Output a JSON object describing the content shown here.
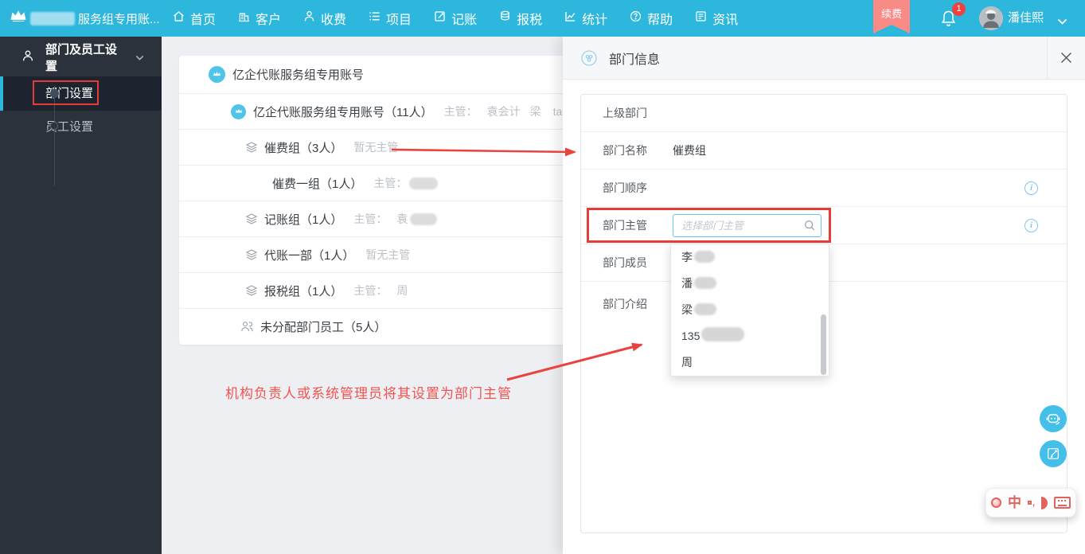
{
  "topbar": {
    "brand_text": "服务组专用账...",
    "nav": [
      {
        "label": "首页",
        "icon": "home-icon"
      },
      {
        "label": "客户",
        "icon": "customers-icon"
      },
      {
        "label": "收费",
        "icon": "fees-icon"
      },
      {
        "label": "项目",
        "icon": "projects-icon"
      },
      {
        "label": "记账",
        "icon": "bookkeeping-icon"
      },
      {
        "label": "报税",
        "icon": "tax-icon"
      },
      {
        "label": "统计",
        "icon": "stats-icon"
      },
      {
        "label": "帮助",
        "icon": "help-icon"
      },
      {
        "label": "资讯",
        "icon": "news-icon"
      }
    ],
    "renew_label": "续费",
    "notification_count": "1",
    "user_name": "潘佳熙"
  },
  "sidebar": {
    "header_label": "部门及员工设置",
    "items": [
      {
        "label": "部门设置",
        "active": true
      },
      {
        "label": "员工设置",
        "active": false
      }
    ]
  },
  "tree": {
    "root_title": "亿企代账服务组专用账号",
    "rows": [
      {
        "name": "亿企代账服务组专用账号（11人）",
        "meta_label": "主管：",
        "sup1": "袁会计",
        "sup2": "梁",
        "sup3": "tao"
      },
      {
        "name": "催费组（3人）",
        "meta_label": "暂无主管"
      },
      {
        "name": "催费一组（1人）",
        "meta_label": "主管："
      },
      {
        "name": "记账组（1人）",
        "meta_label": "主管：",
        "sup1": "袁"
      },
      {
        "name": "代账一部（1人）",
        "meta_label": "暂无主管"
      },
      {
        "name": "报税组（1人）",
        "meta_label": "主管：",
        "sup1": "周"
      },
      {
        "name": "未分配部门员工（5人）"
      }
    ]
  },
  "annotation": {
    "text": "机构负责人或系统管理员将其设置为部门主管"
  },
  "panel": {
    "title": "部门信息",
    "form": {
      "rows": [
        {
          "label": "上级部门",
          "value": ""
        },
        {
          "label": "部门名称",
          "value": "催费组"
        },
        {
          "label": "部门顺序",
          "value": "",
          "info": true
        },
        {
          "label": "部门主管",
          "placeholder": "选择部门主管",
          "info": true,
          "highlighted": true
        },
        {
          "label": "部门成员",
          "value": ""
        },
        {
          "label": "部门介绍",
          "value": ""
        }
      ],
      "info_glyph": "i"
    },
    "dropdown": {
      "items": [
        {
          "text": "李",
          "redacted": true
        },
        {
          "text": "潘",
          "redacted": true
        },
        {
          "text": "梁",
          "redacted": true
        },
        {
          "text": "135",
          "redacted": true
        },
        {
          "text": "周",
          "redacted": false
        }
      ]
    }
  },
  "colors": {
    "accent": "#2db7dd",
    "annotation_red": "#e8433f",
    "sidebar_bg": "#2b323c"
  }
}
